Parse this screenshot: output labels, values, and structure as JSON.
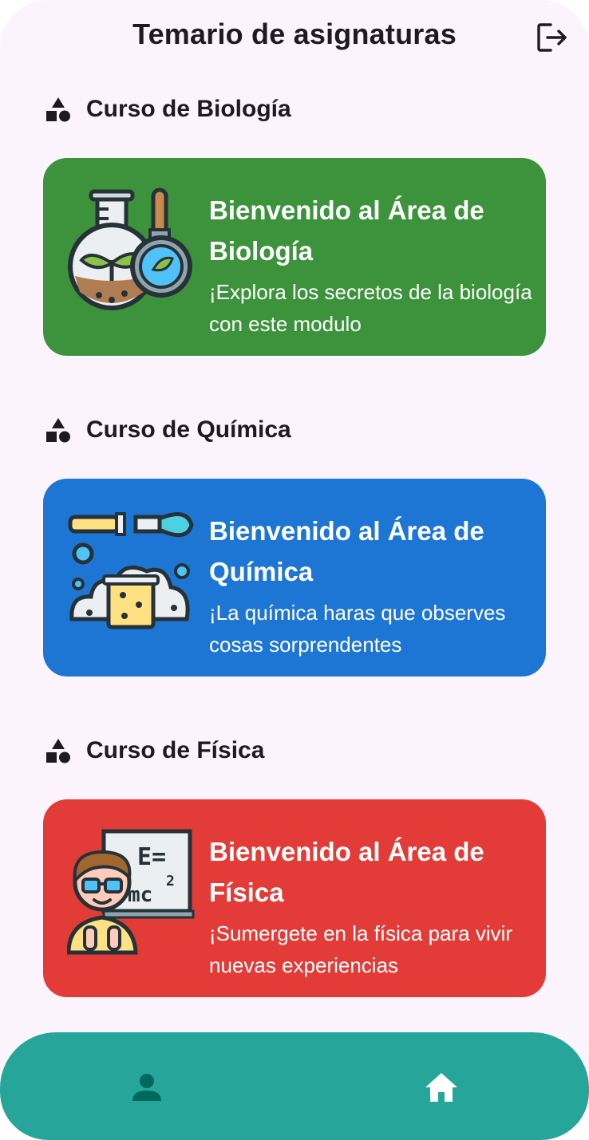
{
  "header": {
    "title": "Temario de asignaturas",
    "logout_icon": "logout-icon"
  },
  "sections": [
    {
      "heading": "Curso de Biología",
      "heading_icon": "category-shapes-icon",
      "card": {
        "title": "Bienvenido al Área de Biología",
        "description": "¡Explora los secretos de la biología con este modulo",
        "color": "#3c933c",
        "illustration": "biology-flask-magnifier-icon"
      }
    },
    {
      "heading": "Curso de Química",
      "heading_icon": "category-shapes-icon",
      "card": {
        "title": "Bienvenido al Área de Química",
        "description": "¡La química haras que observes cosas sorprendentes",
        "color": "#1e76d4",
        "illustration": "chemistry-beaker-icon"
      }
    },
    {
      "heading": "Curso de Física",
      "heading_icon": "category-shapes-icon",
      "card": {
        "title": "Bienvenido al Área de Física",
        "description": "¡Sumergete en la física para vivir nuevas experiencias",
        "color": "#e33b37",
        "illustration": "physics-teacher-icon"
      }
    }
  ],
  "bottom_nav": {
    "color": "#26a69a",
    "items": [
      {
        "icon": "person-icon",
        "active": false
      },
      {
        "icon": "home-icon",
        "active": true
      }
    ]
  }
}
